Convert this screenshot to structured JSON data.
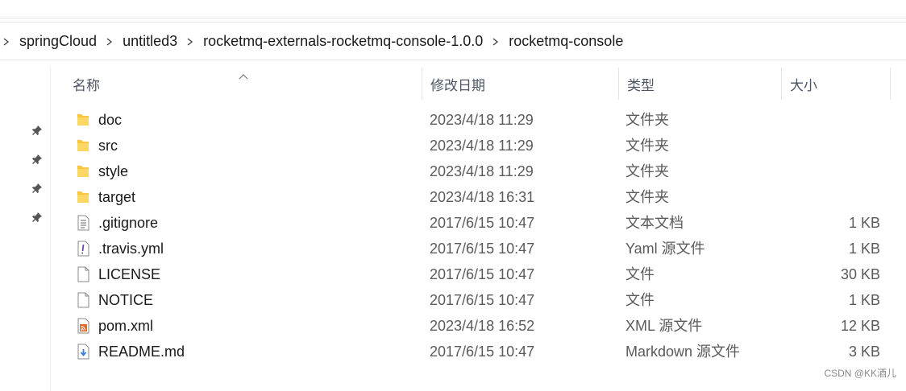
{
  "breadcrumb": [
    "springCloud",
    "untitled3",
    "rocketmq-externals-rocketmq-console-1.0.0",
    "rocketmq-console"
  ],
  "columns": {
    "name": "名称",
    "date": "修改日期",
    "type": "类型",
    "size": "大小"
  },
  "files": [
    {
      "name": "doc",
      "date": "2023/4/18 11:29",
      "type": "文件夹",
      "size": "",
      "icon": "folder-icon"
    },
    {
      "name": "src",
      "date": "2023/4/18 11:29",
      "type": "文件夹",
      "size": "",
      "icon": "folder-icon"
    },
    {
      "name": "style",
      "date": "2023/4/18 11:29",
      "type": "文件夹",
      "size": "",
      "icon": "folder-icon"
    },
    {
      "name": "target",
      "date": "2023/4/18 16:31",
      "type": "文件夹",
      "size": "",
      "icon": "folder-icon"
    },
    {
      "name": ".gitignore",
      "date": "2017/6/15 10:47",
      "type": "文本文档",
      "size": "1 KB",
      "icon": "text-file-icon"
    },
    {
      "name": ".travis.yml",
      "date": "2017/6/15 10:47",
      "type": "Yaml 源文件",
      "size": "1 KB",
      "icon": "yaml-file-icon"
    },
    {
      "name": "LICENSE",
      "date": "2017/6/15 10:47",
      "type": "文件",
      "size": "30 KB",
      "icon": "blank-file-icon"
    },
    {
      "name": "NOTICE",
      "date": "2017/6/15 10:47",
      "type": "文件",
      "size": "1 KB",
      "icon": "blank-file-icon"
    },
    {
      "name": "pom.xml",
      "date": "2023/4/18 16:52",
      "type": "XML 源文件",
      "size": "12 KB",
      "icon": "xml-file-icon"
    },
    {
      "name": "README.md",
      "date": "2017/6/15 10:47",
      "type": "Markdown 源文件",
      "size": "3 KB",
      "icon": "markdown-file-icon"
    }
  ],
  "watermark": "CSDN @KK酒儿",
  "colors": {
    "folder": "#f8c63f",
    "xml": "#e26b28",
    "markdown": "#3b7dd8",
    "yaml": "#7a3ea6"
  }
}
